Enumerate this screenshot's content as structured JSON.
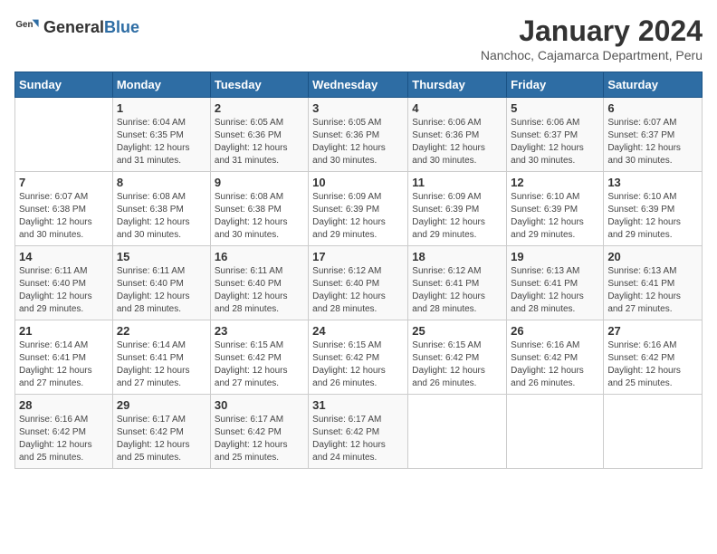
{
  "header": {
    "logo_general": "General",
    "logo_blue": "Blue",
    "month_title": "January 2024",
    "subtitle": "Nanchoc, Cajamarca Department, Peru"
  },
  "days_of_week": [
    "Sunday",
    "Monday",
    "Tuesday",
    "Wednesday",
    "Thursday",
    "Friday",
    "Saturday"
  ],
  "weeks": [
    [
      {
        "num": "",
        "detail": ""
      },
      {
        "num": "1",
        "detail": "Sunrise: 6:04 AM\nSunset: 6:35 PM\nDaylight: 12 hours\nand 31 minutes."
      },
      {
        "num": "2",
        "detail": "Sunrise: 6:05 AM\nSunset: 6:36 PM\nDaylight: 12 hours\nand 31 minutes."
      },
      {
        "num": "3",
        "detail": "Sunrise: 6:05 AM\nSunset: 6:36 PM\nDaylight: 12 hours\nand 30 minutes."
      },
      {
        "num": "4",
        "detail": "Sunrise: 6:06 AM\nSunset: 6:36 PM\nDaylight: 12 hours\nand 30 minutes."
      },
      {
        "num": "5",
        "detail": "Sunrise: 6:06 AM\nSunset: 6:37 PM\nDaylight: 12 hours\nand 30 minutes."
      },
      {
        "num": "6",
        "detail": "Sunrise: 6:07 AM\nSunset: 6:37 PM\nDaylight: 12 hours\nand 30 minutes."
      }
    ],
    [
      {
        "num": "7",
        "detail": "Sunrise: 6:07 AM\nSunset: 6:38 PM\nDaylight: 12 hours\nand 30 minutes."
      },
      {
        "num": "8",
        "detail": "Sunrise: 6:08 AM\nSunset: 6:38 PM\nDaylight: 12 hours\nand 30 minutes."
      },
      {
        "num": "9",
        "detail": "Sunrise: 6:08 AM\nSunset: 6:38 PM\nDaylight: 12 hours\nand 30 minutes."
      },
      {
        "num": "10",
        "detail": "Sunrise: 6:09 AM\nSunset: 6:39 PM\nDaylight: 12 hours\nand 29 minutes."
      },
      {
        "num": "11",
        "detail": "Sunrise: 6:09 AM\nSunset: 6:39 PM\nDaylight: 12 hours\nand 29 minutes."
      },
      {
        "num": "12",
        "detail": "Sunrise: 6:10 AM\nSunset: 6:39 PM\nDaylight: 12 hours\nand 29 minutes."
      },
      {
        "num": "13",
        "detail": "Sunrise: 6:10 AM\nSunset: 6:39 PM\nDaylight: 12 hours\nand 29 minutes."
      }
    ],
    [
      {
        "num": "14",
        "detail": "Sunrise: 6:11 AM\nSunset: 6:40 PM\nDaylight: 12 hours\nand 29 minutes."
      },
      {
        "num": "15",
        "detail": "Sunrise: 6:11 AM\nSunset: 6:40 PM\nDaylight: 12 hours\nand 28 minutes."
      },
      {
        "num": "16",
        "detail": "Sunrise: 6:11 AM\nSunset: 6:40 PM\nDaylight: 12 hours\nand 28 minutes."
      },
      {
        "num": "17",
        "detail": "Sunrise: 6:12 AM\nSunset: 6:40 PM\nDaylight: 12 hours\nand 28 minutes."
      },
      {
        "num": "18",
        "detail": "Sunrise: 6:12 AM\nSunset: 6:41 PM\nDaylight: 12 hours\nand 28 minutes."
      },
      {
        "num": "19",
        "detail": "Sunrise: 6:13 AM\nSunset: 6:41 PM\nDaylight: 12 hours\nand 28 minutes."
      },
      {
        "num": "20",
        "detail": "Sunrise: 6:13 AM\nSunset: 6:41 PM\nDaylight: 12 hours\nand 27 minutes."
      }
    ],
    [
      {
        "num": "21",
        "detail": "Sunrise: 6:14 AM\nSunset: 6:41 PM\nDaylight: 12 hours\nand 27 minutes."
      },
      {
        "num": "22",
        "detail": "Sunrise: 6:14 AM\nSunset: 6:41 PM\nDaylight: 12 hours\nand 27 minutes."
      },
      {
        "num": "23",
        "detail": "Sunrise: 6:15 AM\nSunset: 6:42 PM\nDaylight: 12 hours\nand 27 minutes."
      },
      {
        "num": "24",
        "detail": "Sunrise: 6:15 AM\nSunset: 6:42 PM\nDaylight: 12 hours\nand 26 minutes."
      },
      {
        "num": "25",
        "detail": "Sunrise: 6:15 AM\nSunset: 6:42 PM\nDaylight: 12 hours\nand 26 minutes."
      },
      {
        "num": "26",
        "detail": "Sunrise: 6:16 AM\nSunset: 6:42 PM\nDaylight: 12 hours\nand 26 minutes."
      },
      {
        "num": "27",
        "detail": "Sunrise: 6:16 AM\nSunset: 6:42 PM\nDaylight: 12 hours\nand 25 minutes."
      }
    ],
    [
      {
        "num": "28",
        "detail": "Sunrise: 6:16 AM\nSunset: 6:42 PM\nDaylight: 12 hours\nand 25 minutes."
      },
      {
        "num": "29",
        "detail": "Sunrise: 6:17 AM\nSunset: 6:42 PM\nDaylight: 12 hours\nand 25 minutes."
      },
      {
        "num": "30",
        "detail": "Sunrise: 6:17 AM\nSunset: 6:42 PM\nDaylight: 12 hours\nand 25 minutes."
      },
      {
        "num": "31",
        "detail": "Sunrise: 6:17 AM\nSunset: 6:42 PM\nDaylight: 12 hours\nand 24 minutes."
      },
      {
        "num": "",
        "detail": ""
      },
      {
        "num": "",
        "detail": ""
      },
      {
        "num": "",
        "detail": ""
      }
    ]
  ]
}
